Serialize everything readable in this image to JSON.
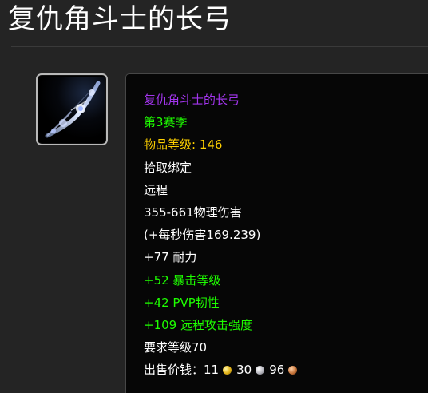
{
  "page": {
    "title": "复仇角斗士的长弓"
  },
  "item_icon": {
    "icon": "longbow-icon"
  },
  "tooltip": {
    "name": "复仇角斗士的长弓",
    "season": "第3赛季",
    "item_level_label": "物品等级: ",
    "item_level_value": "146",
    "binding": "拾取绑定",
    "slot": "远程",
    "damage": "355-661物理伤害",
    "dps": "(+每秒伤害169.239)",
    "stamina": "+77 耐力",
    "crit_rating": "+52 暴击等级",
    "pvp_resilience": "+42 PVP韧性",
    "ranged_ap": "+109 远程攻击强度",
    "required_level": "要求等级70",
    "sell_price": {
      "label": "出售价钱：",
      "gold": "11",
      "silver": "30",
      "copper": "96"
    }
  },
  "colors": {
    "epic": "#a335ee",
    "uncommon": "#1eff00",
    "item_level": "#ffd100",
    "background": "#242424",
    "tooltip_bg": "#060606"
  }
}
